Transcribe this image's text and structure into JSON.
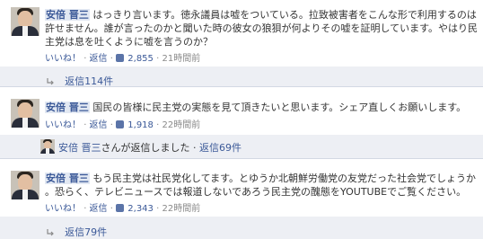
{
  "comments": [
    {
      "author": "安倍 晋三",
      "lines": [
        "はっきり言います。徳永議員は嘘をついている。拉致被害者をこんな形で利用するのは",
        "許せません。誰が言ったのかと聞いた時の彼女の狼狽が何よりその嘘を証明しています。やはり民",
        "主党は息を吐くように嘘を言うのか？"
      ],
      "like": "いいね！",
      "reply": "返信",
      "likes_count": "2,855",
      "time": "21時間前",
      "replies_label": "返信114件"
    },
    {
      "author": "安倍 晋三",
      "lines": [
        "国民の皆様に民主党の実態を見て頂きたいと思います。シェア直しくお願いします。"
      ],
      "like": "いいね！",
      "reply": "返信",
      "likes_count": "1,918",
      "time": "22時間前",
      "shared": {
        "author": "安倍 晋三",
        "text": "さんが返信しました",
        "replies_label": "返信69件"
      }
    },
    {
      "author": "安倍 晋三",
      "lines": [
        "もう民主党は社民党化してます。とゆうか北朝鮮労働党の友党だった社会党でしょうか",
        "。恐らく、テレビニュースでは報道しないであろう民主党の醜態をYOUTUBEでご覧ください。"
      ],
      "like": "いいね！",
      "reply": "返信",
      "likes_count": "2,343",
      "time": "22時間前",
      "replies_label": "返信79件"
    }
  ],
  "separator": " · ",
  "icons": {
    "like": "thumbs-up-icon",
    "reply_arrow": "reply-arrow-icon",
    "avatar": "profile-photo"
  },
  "colors": {
    "link": "#3b5998",
    "band": "#edeff4",
    "meta": "#8a8a8a"
  }
}
